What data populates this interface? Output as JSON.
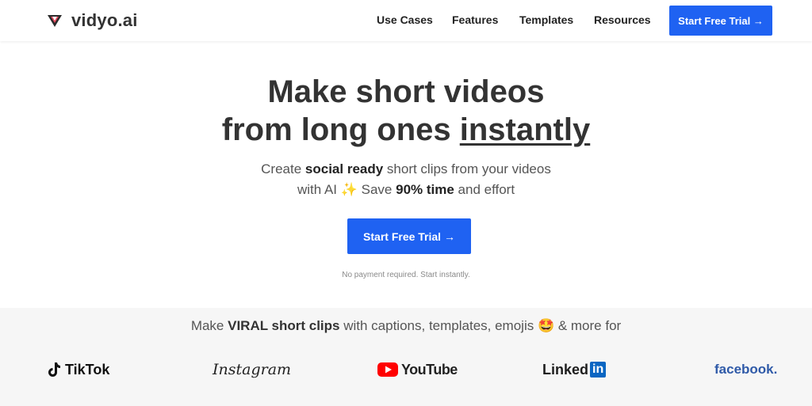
{
  "nav": {
    "logo_text": "vidyo.ai",
    "links": [
      "Use Cases",
      "Features",
      "Templates",
      "Resources"
    ],
    "cta_label": "Start Free Trial →"
  },
  "hero": {
    "title_line1": "Make short videos",
    "title_line2_pre": "from long ones ",
    "title_line2_ul": "instantly",
    "sub_p1": "Create ",
    "sub_b1": "social ready",
    "sub_p2": " short clips from your videos",
    "sub_p3": "with AI ✨ Save ",
    "sub_b2": "90% time",
    "sub_p4": " and effort",
    "cta_label": "Start Free Trial →",
    "note": "No payment required. Start instantly."
  },
  "band": {
    "t1": "Make ",
    "t2": "VIRAL short clips",
    "t3": " with captions, templates, emojis 🤩 & more for",
    "logos": {
      "tiktok": "TikTok",
      "instagram": "Instagram",
      "youtube": "YouTube",
      "linkedin": "Linked",
      "linkedin_in": "in",
      "facebook": "facebook."
    }
  },
  "colors": {
    "accent": "#1f62f2",
    "youtube": "#ff0000",
    "linkedin": "#0a66c2",
    "facebook": "#2f5aa8"
  },
  "icons": [
    "vidyo-logo-icon",
    "arrow-right-icon",
    "tiktok-icon",
    "youtube-play-icon"
  ]
}
